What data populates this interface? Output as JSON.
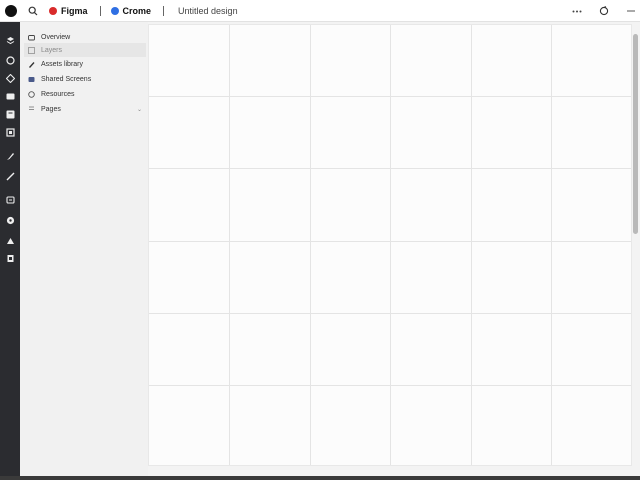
{
  "topbar": {
    "app_logo_icon": "figma-logo-icon",
    "tabs": [
      {
        "label": "Figma",
        "color": "#d92b2b"
      },
      {
        "label": "Crome",
        "color": "#2f6fe3"
      }
    ],
    "file_title": "Untitled design",
    "right_icons": [
      "history-icon",
      "more-icon"
    ]
  },
  "rail": {
    "icons": [
      "layers-icon",
      "shapes-icon",
      "components-icon",
      "media-icon",
      "text-icon",
      "frame-icon",
      "pen-icon",
      "pencil-icon",
      "comment-icon",
      "plugin-icon",
      "upload-icon",
      "trash-icon"
    ]
  },
  "sidebar": {
    "items": [
      {
        "label": "Overview",
        "icon": "home-icon"
      },
      {
        "label": "Layers",
        "icon": "layers-icon",
        "selected": true
      },
      {
        "label": "Assets library",
        "icon": "assets-icon"
      },
      {
        "label": "Shared Screens",
        "icon": "screens-icon"
      },
      {
        "label": "Resources",
        "icon": "resources-icon"
      },
      {
        "label": "Pages",
        "icon": "pages-icon",
        "has_caret": true
      }
    ]
  },
  "colors": {
    "rail_bg": "#2b2c30",
    "sidebar_bg": "#f1f1f1",
    "canvas_bg": "#fcfcfc",
    "grid_line": "#e4e4e4",
    "figma_red": "#d92b2b",
    "chrome_blue": "#2f6fe3"
  },
  "canvas": {
    "columns": 6,
    "rows": 6
  }
}
